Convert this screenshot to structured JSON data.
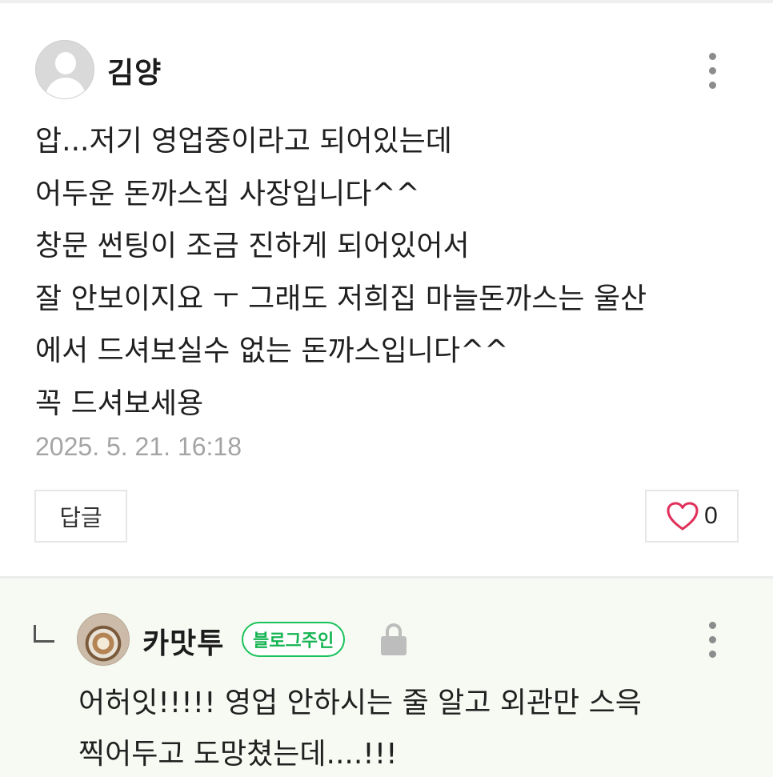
{
  "comment": {
    "author": "김양",
    "avatar_icon": "default-profile-icon",
    "lines": [
      "압...저기 영업중이라고 되어있는데",
      "어두운 돈까스집 사장입니다^^",
      "창문 썬팅이 조금 진하게 되어있어서",
      "잘 안보이지요 ㅜ 그래도 저희집 마늘돈까스는 울산",
      "에서 드셔보실수 없는 돈까스입니다^^",
      "꼭 드셔보세용"
    ],
    "date": "2025. 5. 21. 16:18",
    "reply_label": "답글",
    "like_count": "0",
    "like_icon": "heart-icon",
    "like_color": "#e0305a"
  },
  "reply": {
    "author": "카맛투",
    "badge": "블로그주인",
    "badge_color": "#19c25a",
    "avatar_icon": "coffee-latte-avatar",
    "lock_icon": "lock-icon",
    "lines": [
      "어허잇!!!!!  영업 안하시는 줄 알고 외관만 스윽",
      "찍어두고 도망쳤는데....!!!"
    ]
  }
}
